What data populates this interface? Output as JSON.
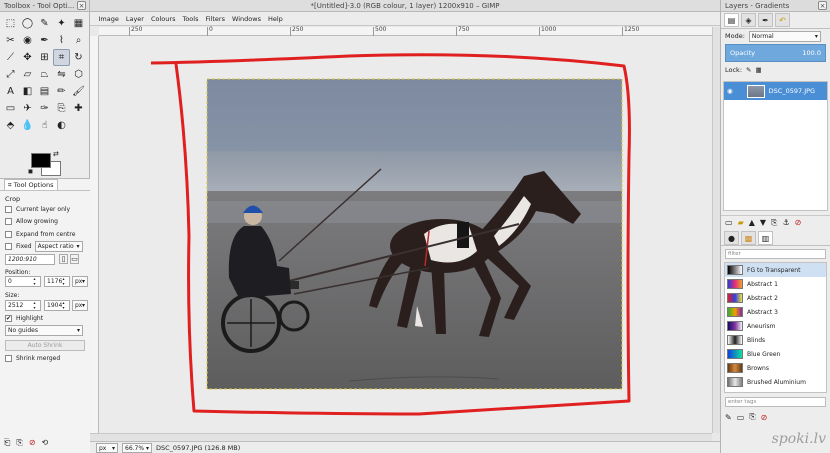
{
  "toolbox": {
    "title": "Toolbox - Tool Opti...",
    "tools": [
      {
        "name": "rect-select-icon",
        "glyph": "⬚"
      },
      {
        "name": "ellipse-select-icon",
        "glyph": "◯"
      },
      {
        "name": "free-select-icon",
        "glyph": "✎"
      },
      {
        "name": "fuzzy-select-icon",
        "glyph": "✦"
      },
      {
        "name": "color-select-icon",
        "glyph": "▦"
      },
      {
        "name": "scissors-select-icon",
        "glyph": "✂"
      },
      {
        "name": "foreground-select-icon",
        "glyph": "◉"
      },
      {
        "name": "paths-icon",
        "glyph": "✒"
      },
      {
        "name": "color-picker-icon",
        "glyph": "⌇"
      },
      {
        "name": "zoom-icon",
        "glyph": "⌕"
      },
      {
        "name": "measure-icon",
        "glyph": "⟋"
      },
      {
        "name": "move-icon",
        "glyph": "✥"
      },
      {
        "name": "align-icon",
        "glyph": "⊞"
      },
      {
        "name": "crop-icon",
        "glyph": "⌗"
      },
      {
        "name": "rotate-icon",
        "glyph": "↻"
      },
      {
        "name": "scale-icon",
        "glyph": "⤢"
      },
      {
        "name": "shear-icon",
        "glyph": "▱"
      },
      {
        "name": "perspective-icon",
        "glyph": "⏢"
      },
      {
        "name": "flip-icon",
        "glyph": "⇋"
      },
      {
        "name": "cage-icon",
        "glyph": "⬡"
      },
      {
        "name": "text-icon",
        "glyph": "A"
      },
      {
        "name": "bucket-fill-icon",
        "glyph": "◧"
      },
      {
        "name": "blend-icon",
        "glyph": "▤"
      },
      {
        "name": "pencil-icon",
        "glyph": "✏"
      },
      {
        "name": "paintbrush-icon",
        "glyph": "🖌"
      },
      {
        "name": "eraser-icon",
        "glyph": "▭"
      },
      {
        "name": "airbrush-icon",
        "glyph": "✈"
      },
      {
        "name": "ink-icon",
        "glyph": "✑"
      },
      {
        "name": "clone-icon",
        "glyph": "⎘"
      },
      {
        "name": "heal-icon",
        "glyph": "✚"
      },
      {
        "name": "perspective-clone-icon",
        "glyph": "⬘"
      },
      {
        "name": "blur-icon",
        "glyph": "💧"
      },
      {
        "name": "smudge-icon",
        "glyph": "☝"
      },
      {
        "name": "dodge-burn-icon",
        "glyph": "◐"
      }
    ],
    "active_tool_index": 13
  },
  "tool_options": {
    "tab_label": "Tool Options",
    "section": "Crop",
    "current_layer_only": "Current layer only",
    "allow_growing": "Allow growing",
    "expand_from_centre": "Expand from centre",
    "fixed_label": "Fixed",
    "fixed_value": "Aspect ratio",
    "ratio_value": "1200:910",
    "position_label": "Position:",
    "position_x": "0",
    "position_y": "1176",
    "position_unit": "px",
    "size_label": "Size:",
    "size_w": "2512",
    "size_h": "1904",
    "size_unit": "px",
    "highlight_label": "Highlight",
    "guides_value": "No guides",
    "auto_shrink": "Auto Shrink",
    "shrink_merged": "Shrink merged"
  },
  "image_window": {
    "title": "*[Untitled]-3.0 (RGB colour, 1 layer) 1200x910 – GIMP",
    "menus": [
      "Image",
      "Layer",
      "Colours",
      "Tools",
      "Filters",
      "Windows",
      "Help"
    ],
    "ruler_labels": [
      "250",
      "0",
      "250",
      "500",
      "750",
      "1000",
      "1250"
    ],
    "status_unit": "px",
    "status_zoom": "66.7%",
    "status_info": "DSC_0597.JPG (126.8 MB)"
  },
  "dock": {
    "title": "Layers - Gradients",
    "mode_label": "Mode:",
    "mode_value": "Normal",
    "opacity_label": "Opacity",
    "opacity_value": "100.0",
    "lock_label": "Lock:",
    "layer_name": "DSC_0597.JPG",
    "gradient_filter_placeholder": "filter",
    "gradient_tags_placeholder": "enter tags",
    "gradients": [
      {
        "name": "FG to Transparent",
        "colors": [
          "#000000",
          "#ffffff"
        ]
      },
      {
        "name": "Abstract 1",
        "colors": [
          "#2a3bd6",
          "#e0307a",
          "#f0a030"
        ]
      },
      {
        "name": "Abstract 2",
        "colors": [
          "#e02020",
          "#3040e0",
          "#f0e040"
        ]
      },
      {
        "name": "Abstract 3",
        "colors": [
          "#30b030",
          "#f0a000",
          "#9020a0"
        ]
      },
      {
        "name": "Aneurism",
        "colors": [
          "#101060",
          "#8030a0",
          "#f0f0f0"
        ]
      },
      {
        "name": "Blinds",
        "colors": [
          "#ffffff",
          "#202020",
          "#ffffff"
        ]
      },
      {
        "name": "Blue Green",
        "colors": [
          "#1040e0",
          "#10e0a0"
        ]
      },
      {
        "name": "Browns",
        "colors": [
          "#6a3a10",
          "#d08a40",
          "#6a3a10"
        ]
      },
      {
        "name": "Brushed Aluminium",
        "colors": [
          "#707070",
          "#e8e8e8",
          "#808080"
        ]
      }
    ],
    "selected_gradient_index": 0
  },
  "watermark": "spoki.lv",
  "colors": {
    "selection_highlight": "#4a8fd6",
    "annotation_red": "#e02020"
  }
}
